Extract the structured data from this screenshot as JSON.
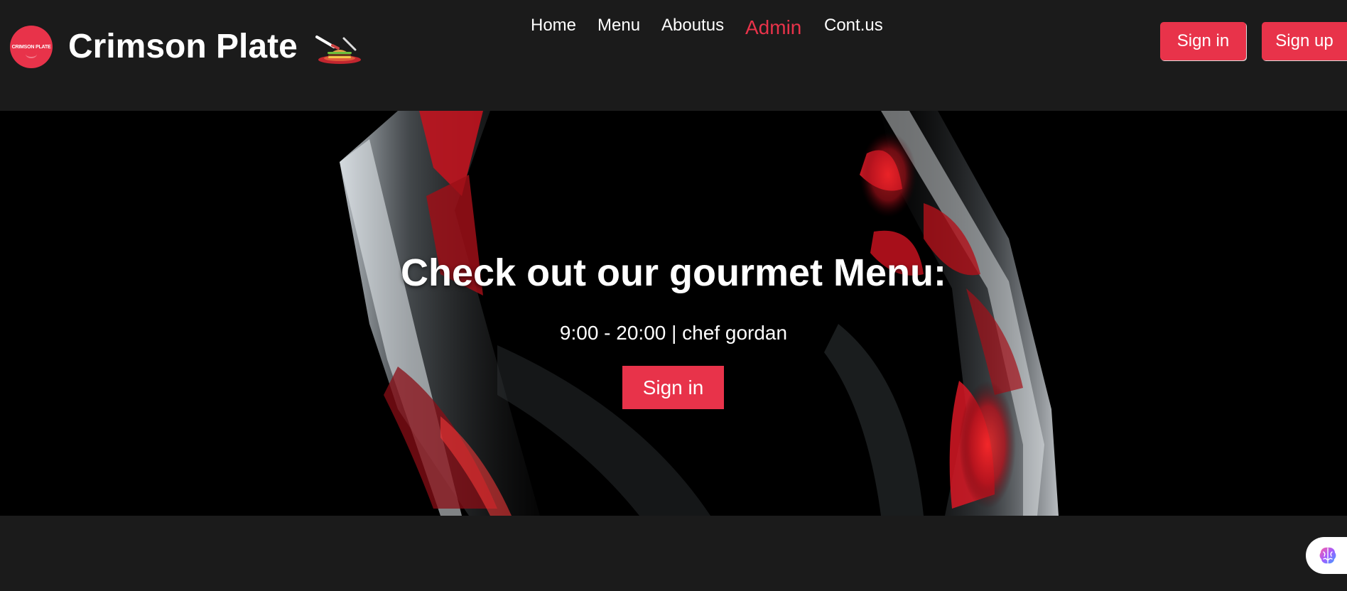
{
  "brand": {
    "badge_text": "CRIMSON PLATE",
    "name": "Crimson Plate",
    "icon": "burger-plate-icon"
  },
  "nav": {
    "items": [
      {
        "label": "Home",
        "active": false
      },
      {
        "label": "Menu",
        "active": false
      },
      {
        "label": "Aboutus",
        "active": false
      },
      {
        "label": "Admin",
        "active": true
      },
      {
        "label": "Cont.us",
        "active": false
      }
    ]
  },
  "auth": {
    "sign_in_label": "Sign in",
    "sign_up_label": "Sign up"
  },
  "hero": {
    "title": "Check out our gourmet Menu:",
    "subtitle": "9:00 - 20:00 | chef gordan",
    "cta_label": "Sign in",
    "background": "wine-glass-image"
  },
  "assistant": {
    "icon": "brain-icon"
  },
  "colors": {
    "accent": "#e8334a",
    "background": "#1b1b1b",
    "hero_background": "#000000"
  }
}
